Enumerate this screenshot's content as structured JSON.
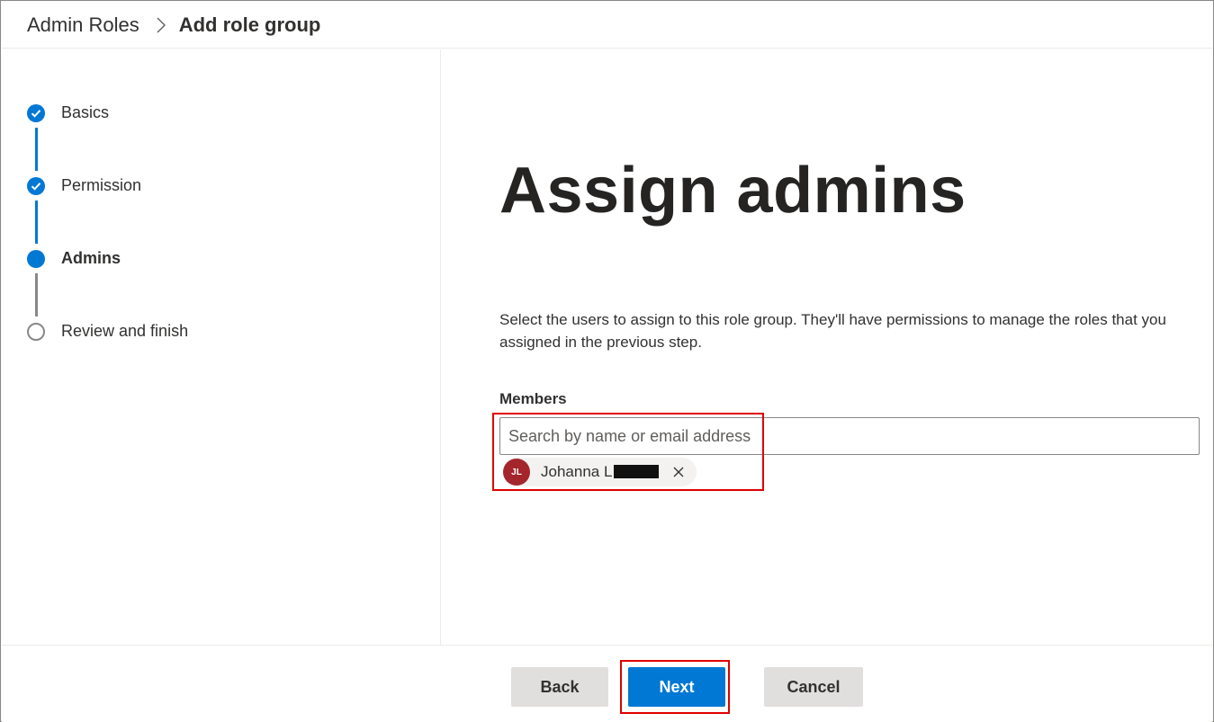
{
  "breadcrumb": {
    "root": "Admin Roles",
    "current": "Add role group",
    "separator_icon": "chevron-right-icon"
  },
  "steps": [
    {
      "label": "Basics",
      "state": "completed"
    },
    {
      "label": "Permission",
      "state": "completed"
    },
    {
      "label": "Admins",
      "state": "current"
    },
    {
      "label": "Review and finish",
      "state": "not-started"
    }
  ],
  "main": {
    "title": "Assign admins",
    "description": "Select the users to assign to this role group. They'll have permissions to manage the roles that you assigned in the previous step.",
    "members_label": "Members",
    "search_placeholder": "Search by name or email address",
    "selected_members": [
      {
        "initials": "JL",
        "name": "Johanna L",
        "name_redacted": true
      }
    ]
  },
  "footer": {
    "back_label": "Back",
    "next_label": "Next",
    "cancel_label": "Cancel"
  },
  "colors": {
    "accent": "#0078d4",
    "avatar": "#a4262c",
    "highlight": "#e00000"
  }
}
